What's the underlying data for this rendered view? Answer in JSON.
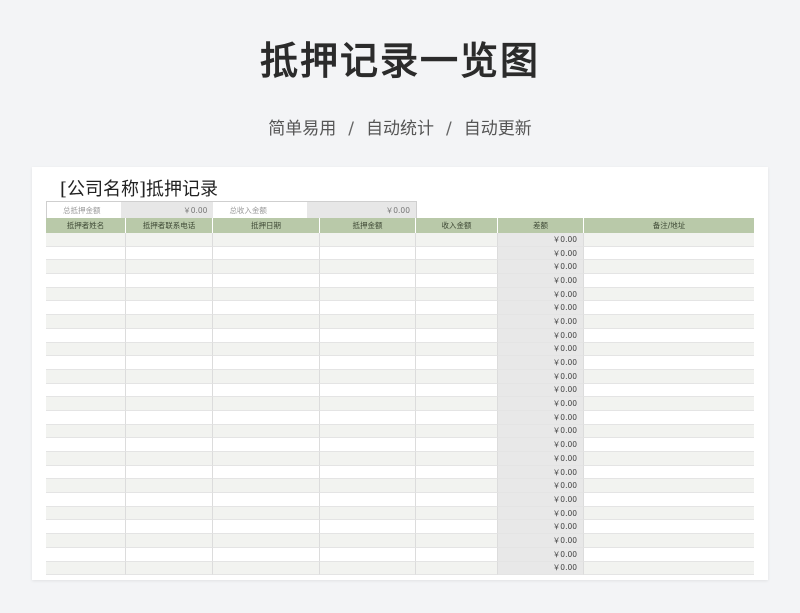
{
  "page": {
    "title": "抵押记录一览图",
    "subtitle": [
      "简单易用",
      "自动统计",
      "自动更新"
    ],
    "separator": "/"
  },
  "sheet": {
    "title": "[公司名称]抵押记录",
    "summary": {
      "total_mortgage_label": "总抵押金额",
      "total_mortgage_value": "￥0.00",
      "total_income_label": "总收入金额",
      "total_income_value": "￥0.00"
    },
    "columns": [
      "抵押者姓名",
      "抵押者联系电话",
      "抵押日期",
      "抵押金额",
      "收入金额",
      "差额",
      "备注/地址"
    ],
    "row_diff_value": "￥0.00",
    "row_count": 25
  }
}
